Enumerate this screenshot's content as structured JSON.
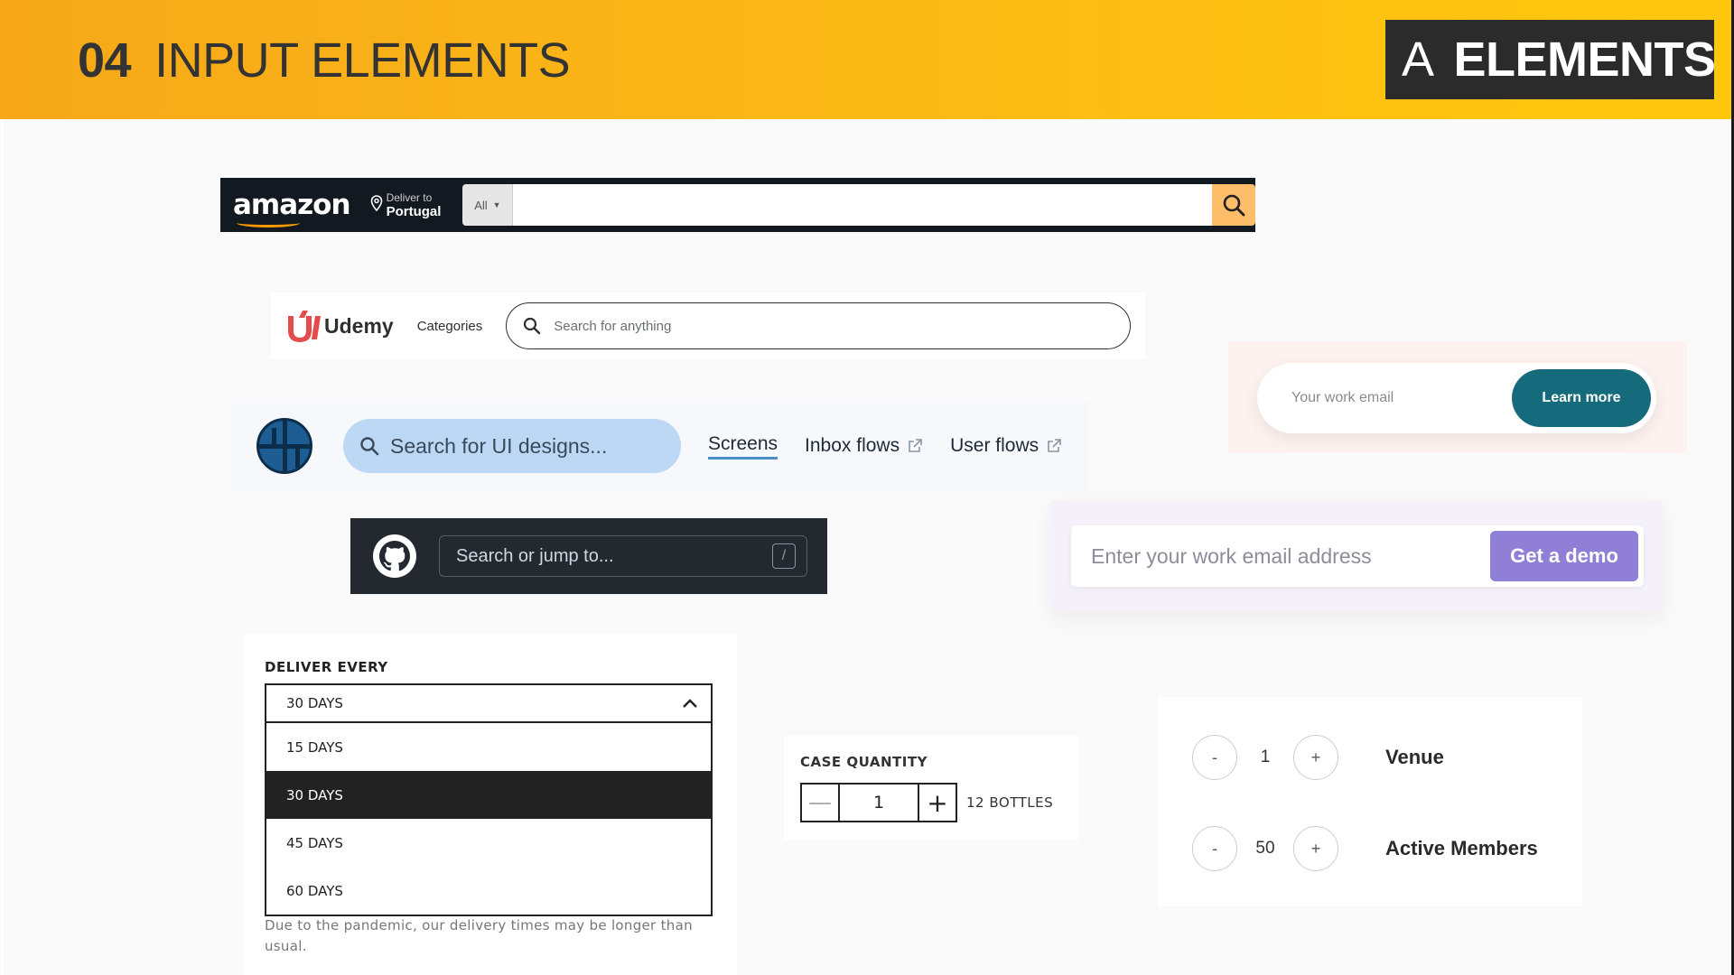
{
  "header": {
    "number": "04",
    "title": "INPUT ELEMENTS",
    "badge_prefix": "A",
    "badge_text": "ELEMENTS"
  },
  "amazon": {
    "logo": "amazon",
    "deliver_label": "Deliver to",
    "deliver_location": "Portugal",
    "category": "All",
    "search_value": ""
  },
  "udemy": {
    "logo": "Udemy",
    "categories": "Categories",
    "search_placeholder": "Search for anything"
  },
  "screenlane": {
    "search_placeholder": "Search for UI designs...",
    "links": [
      "Screens",
      "Inbox flows",
      "User flows"
    ]
  },
  "learn_more": {
    "placeholder": "Your work email",
    "button": "Learn more"
  },
  "github": {
    "search_placeholder": "Search or jump to...",
    "shortcut": "/"
  },
  "demo": {
    "placeholder": "Enter your work email address",
    "button": "Get a demo"
  },
  "deliver": {
    "label": "DELIVER EVERY",
    "selected": "30 DAYS",
    "options": [
      "15 DAYS",
      "30 DAYS",
      "45 DAYS",
      "60 DAYS"
    ],
    "note": "Due to the pandemic, our delivery times may be longer than usual."
  },
  "case_quantity": {
    "label": "CASE QUANTITY",
    "value": "1",
    "minus": "—",
    "plus": "+",
    "unit": "12 BOTTLES"
  },
  "steppers": [
    {
      "label": "Venue",
      "value": "1",
      "minus": "-",
      "plus": "+"
    },
    {
      "label": "Active Members",
      "value": "50",
      "minus": "-",
      "plus": "+"
    }
  ],
  "colors": {
    "header_gradient_start": "#f6a818",
    "header_gradient_end": "#fec70c",
    "amazon_bar": "#131921",
    "amazon_search_button": "#febd69",
    "udemy_red": "#e54b4b",
    "learn_more_teal": "#156a7b",
    "demo_purple": "#8f7fd6",
    "github_bar": "#24292f"
  }
}
